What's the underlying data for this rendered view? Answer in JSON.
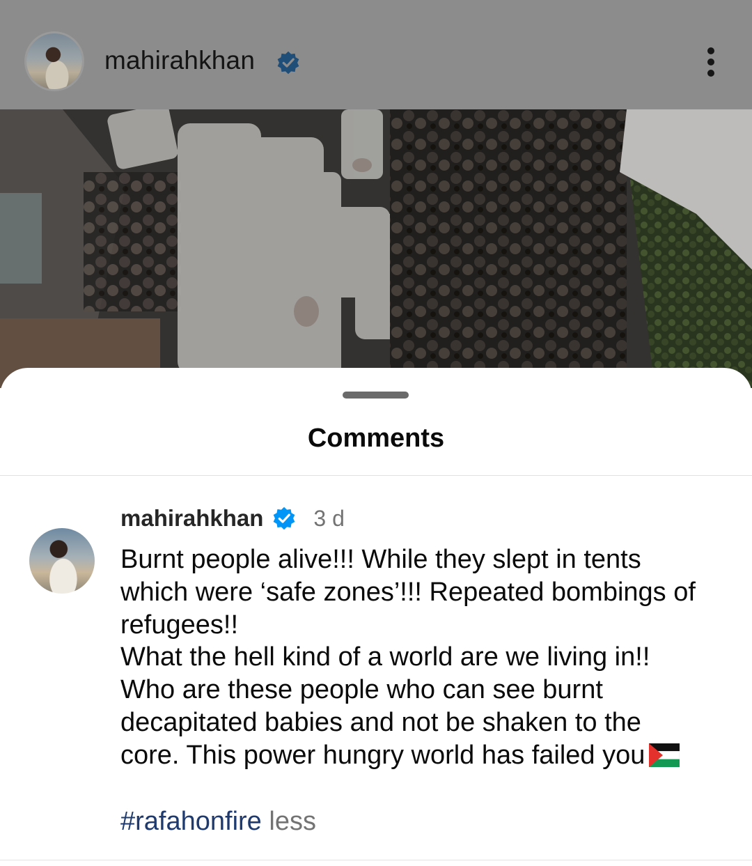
{
  "post": {
    "username": "mahirahkhan",
    "avatar": "profile-photo",
    "verified_icon": "verified-badge-icon",
    "more_icon": "more-vertical-icon"
  },
  "comments_sheet": {
    "title": "Comments",
    "comment": {
      "username": "mahirahkhan",
      "time": "3 d",
      "lines": [
        "Burnt people alive!!! While they slept in tents",
        "which were ‘safe zones’!!! Repeated bombings of",
        "refugees!!",
        "What the hell kind of a world are we living in!!",
        "Who are these people who can see burnt",
        "decapitated babies and not be shaken to the",
        "core. This power hungry world has failed you"
      ],
      "flag_icon": "palestine-flag-icon",
      "hashtag": "#rafahonfire",
      "less_label": "less"
    }
  },
  "colors": {
    "header_dim": "#8c8c8c",
    "verified_blue": "#0095f6",
    "hashtag": "#1e3a6e",
    "muted": "#737373"
  }
}
